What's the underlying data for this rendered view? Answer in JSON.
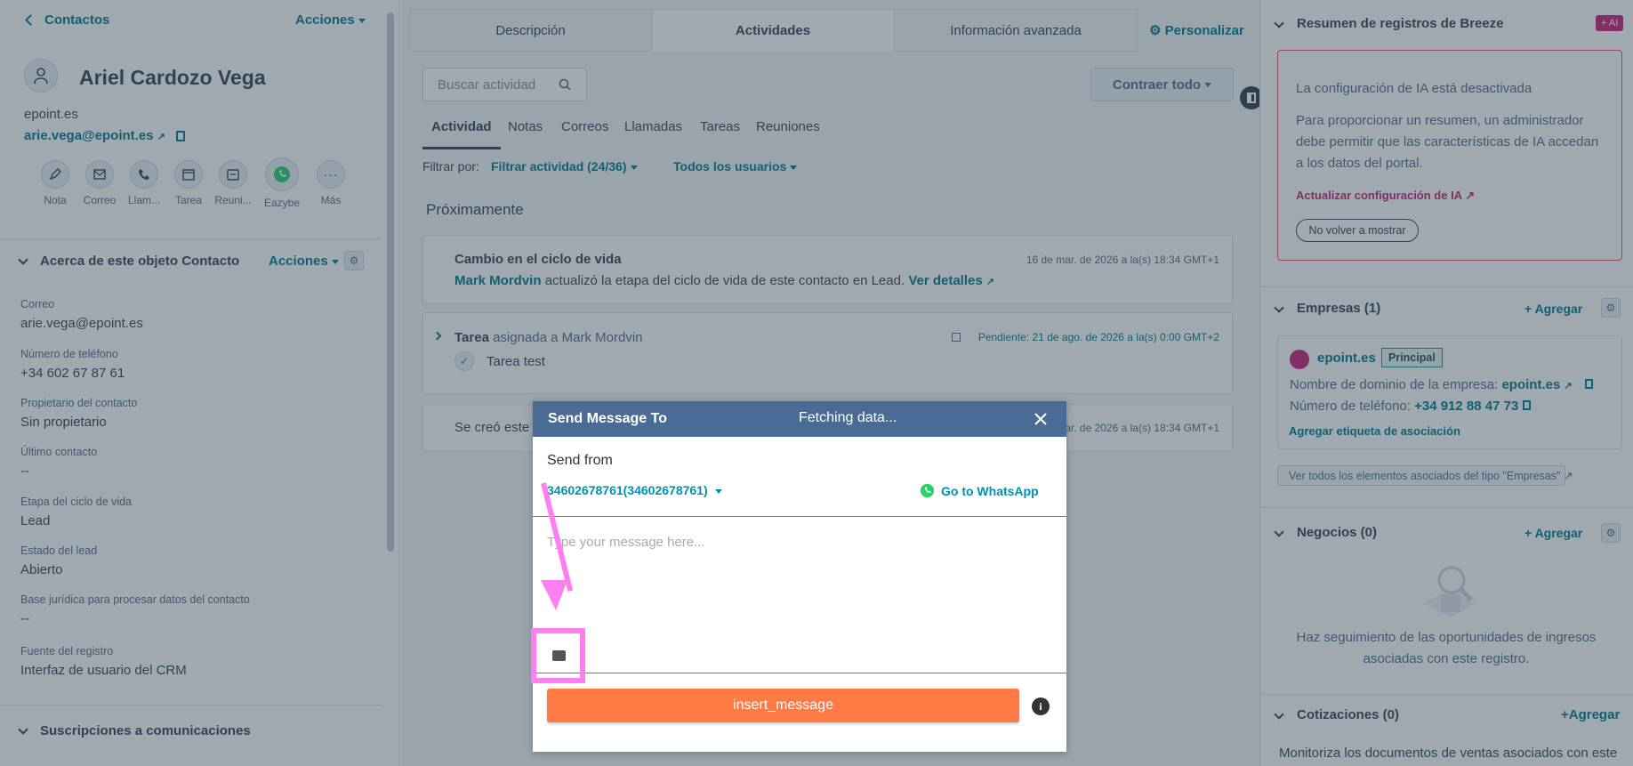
{
  "left": {
    "back_label": "Contactos",
    "actions_label": "Acciones",
    "contact_name": "Ariel Cardozo Vega",
    "domain": "epoint.es",
    "email": "arie.vega@epoint.es",
    "quick_actions": [
      "Nota",
      "Correo",
      "Llam...",
      "Tarea",
      "Reuni...",
      "Eazybe",
      "Más"
    ],
    "about_title": "Acerca de este objeto Contacto",
    "about_actions": "Acciones",
    "properties": [
      {
        "label": "Correo",
        "value": "arie.vega@epoint.es"
      },
      {
        "label": "Número de teléfono",
        "value": "+34 602 67 87 61"
      },
      {
        "label": "Propietario del contacto",
        "value": "Sin propietario"
      },
      {
        "label": "Último contacto",
        "value": "--"
      },
      {
        "label": "Etapa del ciclo de vida",
        "value": "Lead"
      },
      {
        "label": "Estado del lead",
        "value": "Abierto"
      },
      {
        "label": "Base jurídica para procesar datos del contacto",
        "value": "--"
      },
      {
        "label": "Fuente del registro",
        "value": "Interfaz de usuario del CRM"
      }
    ],
    "subscriptions_title": "Suscripciones a comunicaciones"
  },
  "center": {
    "tabs": [
      "Descripción",
      "Actividades",
      "Información avanzada"
    ],
    "customize_label": "Personalizar",
    "search_placeholder": "Buscar actividad",
    "collapse_label": "Contraer todo",
    "subtabs": [
      "Actividad",
      "Notas",
      "Correos",
      "Llamadas",
      "Tareas",
      "Reuniones"
    ],
    "filter_prefix": "Filtrar por:",
    "filter_activity": "Filtrar actividad (24/36)",
    "filter_users": "Todos los usuarios",
    "upcoming_label": "Próximamente",
    "lifecycle": {
      "title": "Cambio en el ciclo de vida",
      "date": "16 de mar. de 2026 a la(s) 18:34 GMT+1",
      "user": "Mark Mordvin",
      "text": "actualizó la etapa del ciclo de vida de este contacto en Lead.",
      "details": "Ver detalles"
    },
    "task": {
      "title": "Tarea",
      "assigned": "asignada a Mark Mordvin",
      "due": "Pendiente: 21 de ago. de 2026 a la(s) 0:00 GMT+2",
      "name": "Tarea test"
    },
    "created": {
      "text": "Se creó este c",
      "date": "ar. de 2026 a la(s) 18:34 GMT+1"
    }
  },
  "right": {
    "breeze_title": "Resumen de registros de Breeze",
    "ai_badge": "+ AI",
    "ai_disabled": "La configuración de IA está desactivada",
    "ai_text_1": "Para proporcionar un resumen, un administrador",
    "ai_text_2": "debe permitir que las características de IA accedan",
    "ai_text_3": "a los datos del portal.",
    "ai_update_link": "Actualizar configuración de IA",
    "ai_dismiss": "No volver a mostrar",
    "companies_title": "Empresas (1)",
    "add_label": "Agregar",
    "company_name": "epoint.es",
    "company_badge": "Principal",
    "company_domain_label": "Nombre de dominio de la empresa:",
    "company_domain": "epoint.es",
    "company_phone_label": "Número de teléfono:",
    "company_phone": "+34 912 88 47 73",
    "assoc_label": "Agregar etiqueta de asociación",
    "view_all": "Ver todos los elementos asociados del tipo \"Empresas\"",
    "deals_title": "Negocios (0)",
    "deals_empty_1": "Haz seguimiento de las oportunidades de ingresos",
    "deals_empty_2": "asociadas con este registro.",
    "quotes_title": "Cotizaciones (0)",
    "quotes_add": "+Agregar",
    "quotes_text": "Monitoriza los documentos de ventas asociados con este"
  },
  "modal": {
    "title": "Send Message To",
    "status": "Fetching data...",
    "send_from_label": "Send from",
    "send_from_value": "34602678761(34602678761)",
    "go_whatsapp": "Go to WhatsApp",
    "placeholder": "Type your message here...",
    "insert_label": "insert_message"
  },
  "colors": {
    "accent": "#007a8c",
    "modal_header": "#4a6b96",
    "insert_button": "#ff7a45",
    "annotation": "#ff7ff0",
    "whatsapp": "#25d366",
    "ai_badge": "#c7237a"
  }
}
